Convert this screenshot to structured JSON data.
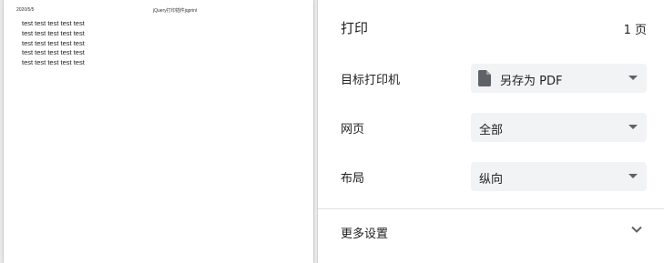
{
  "preview": {
    "header_date": "2020/5/5",
    "header_title": "jQuery打印插件jqprint",
    "lines": [
      "test test test test test",
      "test test test test test",
      "test test test test test",
      "test test test test test",
      "test test test test test"
    ]
  },
  "panel": {
    "title": "打印",
    "page_count": "1 页",
    "destination": {
      "label": "目标打印机",
      "value": "另存为 PDF",
      "icon": "document-icon"
    },
    "pages": {
      "label": "网页",
      "value": "全部"
    },
    "layout": {
      "label": "布局",
      "value": "纵向"
    },
    "more_settings": {
      "label": "更多设置",
      "icon": "chevron-down-icon"
    }
  }
}
